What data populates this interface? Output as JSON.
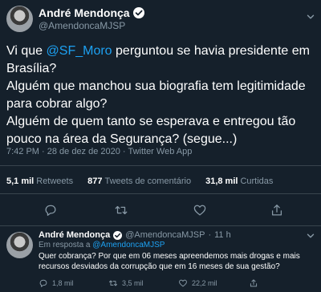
{
  "tweet": {
    "author_name": "André Mendonça",
    "handle": "@AmendoncaMJSP",
    "text": {
      "p1_pre": "Vi que ",
      "p1_mention": "@SF_Moro",
      "p1_post": " perguntou se havia presidente em Brasília?",
      "p2": "Alguém que manchou sua biografia tem legitimidade para cobrar algo?",
      "p3": "Alguém de quem tanto se esperava e entregou tão pouco na área da Segurança? (segue...)"
    },
    "meta": "7:42 PM · 28 de dez de 2020 · Twitter Web App",
    "stats": {
      "retweets_count": "5,1 mil",
      "retweets_label": "Retweets",
      "quotes_count": "877",
      "quotes_label": "Tweets de comentário",
      "likes_count": "31,8 mil",
      "likes_label": "Curtidas"
    },
    "actions": [
      "reply-icon",
      "retweet-icon",
      "like-icon",
      "share-icon"
    ]
  },
  "reply": {
    "author_name": "André Mendonça",
    "handle": "@AmendoncaMJSP",
    "separator": "·",
    "time": "11 h",
    "in_reply_label": "Em resposta a",
    "in_reply_mention": "@AmendoncaMJSP",
    "text": "Quer cobrança? Por que em 06 meses apreendemos mais drogas e mais recursos desviados da corrupção que em 16 meses de sua gestão?",
    "replies": "1,8 mil",
    "retweets": "3,5 mil",
    "likes": "22,2 mil"
  },
  "colors": {
    "background": "#15202b",
    "accent": "#1da1f2",
    "secondary_text": "#8899a6",
    "divider": "#38444d"
  }
}
